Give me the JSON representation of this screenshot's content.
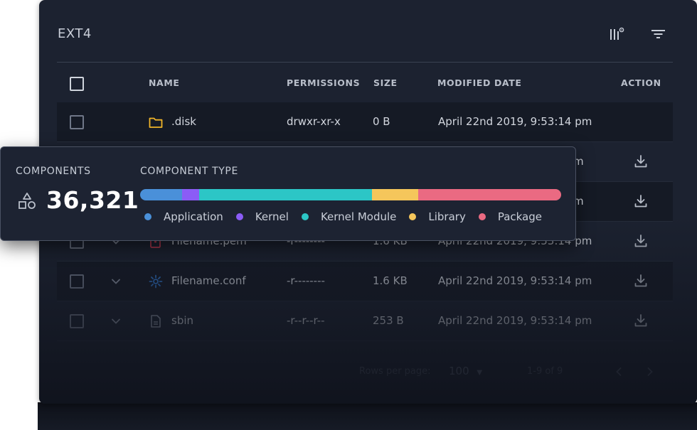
{
  "panel": {
    "title": "EXT4",
    "columns_icon": "columns-settings-icon",
    "filter_icon": "filter-icon"
  },
  "table": {
    "headers": {
      "name": "NAME",
      "permissions": "PERMISSIONS",
      "size": "SIZE",
      "modified": "MODIFIED DATE",
      "action": "ACTION"
    },
    "rows": [
      {
        "name": ".disk",
        "icon": "folder-icon",
        "permissions": "drwxr-xr-x",
        "size": "0 B",
        "modified": "April 22nd 2019, 9:53:14 pm",
        "has_action": false,
        "expandable": false
      },
      {
        "name": "",
        "icon": "",
        "permissions": "",
        "size": "",
        "modified": "m",
        "has_action": true,
        "expandable": false
      },
      {
        "name": "",
        "icon": "",
        "permissions": "",
        "size": "",
        "modified": "m",
        "has_action": true,
        "expandable": false
      },
      {
        "name": "Filename.pem",
        "icon": "certificate-icon",
        "permissions": "-r--------",
        "size": "1.6 KB",
        "modified": "April 22nd 2019, 9:53:14 pm",
        "has_action": true,
        "expandable": true
      },
      {
        "name": "Filename.conf",
        "icon": "gear-icon",
        "permissions": "-r--------",
        "size": "1.6 KB",
        "modified": "April 22nd 2019, 9:53:14 pm",
        "has_action": true,
        "expandable": true
      },
      {
        "name": "sbin",
        "icon": "file-icon",
        "permissions": "-r--r--r--",
        "size": "253 B",
        "modified": "April 22nd 2019, 9:53:14 pm",
        "has_action": true,
        "expandable": true
      }
    ],
    "footer": {
      "rows_per_page_label": "Rows per page:",
      "rows_per_page_value": "100",
      "range": "1-9 of 9"
    }
  },
  "stats": {
    "components_label": "COMPONENTS",
    "components_count": "36,321",
    "components_icon": "shapes-icon",
    "type_label": "COMPONENT TYPE",
    "breakdown": [
      {
        "label": "Application",
        "color": "#4a90d9",
        "fraction": 0.1
      },
      {
        "label": "Kernel",
        "color": "#8b5cf6",
        "fraction": 0.04
      },
      {
        "label": "Kernel Module",
        "color": "#2cc6c6",
        "fraction": 0.41
      },
      {
        "label": "Library",
        "color": "#f5c65b",
        "fraction": 0.11
      },
      {
        "label": "Package",
        "color": "#ea6a82",
        "fraction": 0.34
      }
    ]
  },
  "colors": {
    "panel_bg": "#1c2230",
    "folder": "#f0b429",
    "certificate": "#c43a52",
    "gear": "#2f6fbf"
  }
}
